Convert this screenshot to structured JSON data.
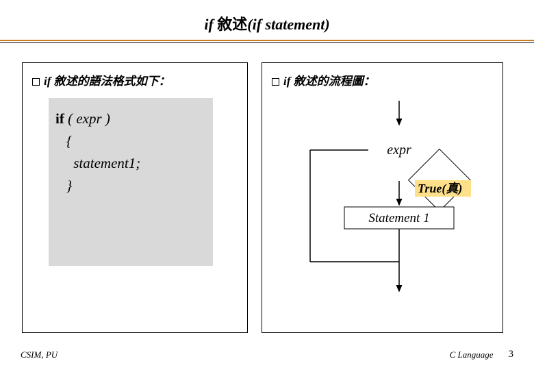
{
  "title": {
    "if_word": "if ",
    "cn": "敘述",
    "paren": "(if statement)"
  },
  "left": {
    "heading_if": "if ",
    "heading_cn": "敘述的語法格式如下：",
    "code": {
      "l1": "if ( expr )",
      "l2": "   {",
      "l3": "     statement1;",
      "l4": "   }"
    }
  },
  "right": {
    "heading_if": "if ",
    "heading_cn": "敘述的流程圖：",
    "diagram": {
      "expr": "expr",
      "true_en": "True(",
      "true_cn": "真",
      "true_close": ")",
      "stmt": "Statement 1"
    }
  },
  "footer": {
    "left": "CSIM, PU",
    "clabel": "C Language",
    "page": "3"
  }
}
